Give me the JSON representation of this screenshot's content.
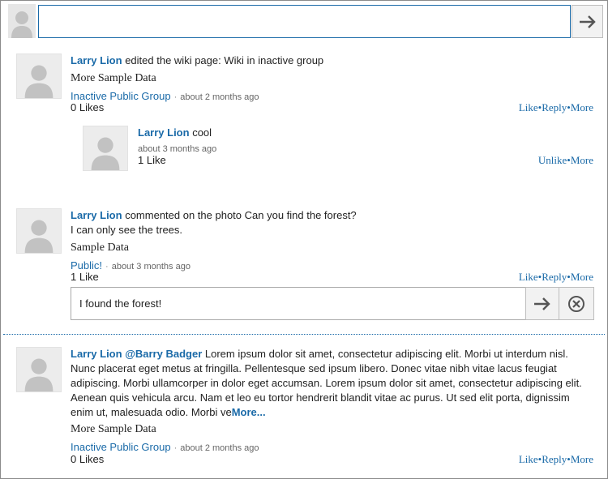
{
  "composer": {
    "placeholder": "",
    "submit_icon": "arrow-right-icon"
  },
  "feed": {
    "item1": {
      "author": "Larry Lion",
      "action_text": "edited the wiki page: Wiki in inactive group",
      "body": "More Sample Data",
      "group": "Inactive Public Group",
      "time": "about 2 months ago",
      "likes": "0 Likes",
      "actions": {
        "like": "Like",
        "reply": "Reply",
        "more": "More",
        "sep": "•"
      },
      "reply": {
        "author": "Larry Lion",
        "text": "cool",
        "time": "about 3 months ago",
        "likes": "1 Like",
        "actions": {
          "unlike": "Unlike",
          "more": "More",
          "sep": "•"
        }
      }
    },
    "item2": {
      "author": "Larry Lion",
      "action_text": "commented on the photo Can you find the forest?",
      "line2": "I can only see the trees.",
      "body": "Sample Data",
      "group": "Public!",
      "time": "about 3 months ago",
      "likes": "1 Like",
      "actions": {
        "like": "Like",
        "reply": "Reply",
        "more": "More",
        "sep": "•"
      },
      "reply_input_value": "I found the forest!"
    },
    "item3": {
      "author": "Larry Lion",
      "mention": "@Barry Badger",
      "text_l1": " Lorem ipsum dolor sit amet, consectetur adipiscing elit. Morbi ut interdum nisl.",
      "text_l2": "Nunc placerat eget metus at fringilla. Pellentesque sed ipsum libero. Donec vitae nibh vitae lacus feugiat",
      "text_l3": "adipiscing. Morbi ullamcorper in dolor eget accumsan. Lorem ipsum dolor sit amet, consectetur adipiscing elit.",
      "text_l4": "Aenean quis vehicula arcu. Nam et leo eu tortor hendrerit blandit vitae ac purus. Ut sed elit porta, dignissim",
      "text_l5": "enim ut, malesuada odio. Morbi ve",
      "more_link": "More...",
      "body": "More Sample Data",
      "group": "Inactive Public Group",
      "time": "about 2 months ago",
      "likes": "0 Likes",
      "actions": {
        "like": "Like",
        "reply": "Reply",
        "more": "More",
        "sep": "•"
      }
    }
  },
  "colors": {
    "link": "#1a6aa8",
    "accent_border": "#1a6aa8"
  }
}
